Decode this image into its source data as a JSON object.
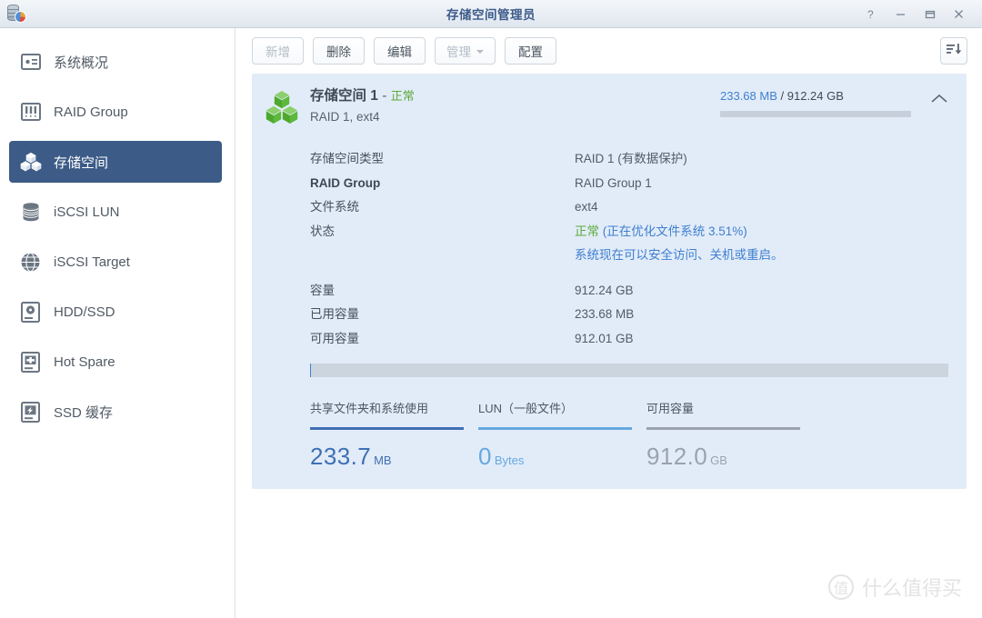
{
  "window": {
    "title": "存储空间管理员",
    "app_icon": "storage-manager-icon",
    "controls": {
      "help": "?",
      "minimize": "−",
      "maximize": "□",
      "close": "✕"
    }
  },
  "sidebar": {
    "items": [
      {
        "label": "系统概况",
        "icon": "overview-card-icon",
        "selected": false
      },
      {
        "label": "RAID Group",
        "icon": "raid-group-icon",
        "selected": false
      },
      {
        "label": "存储空间",
        "icon": "volume-cubes-icon",
        "selected": true
      },
      {
        "label": "iSCSI LUN",
        "icon": "disk-stack-icon",
        "selected": false
      },
      {
        "label": "iSCSI Target",
        "icon": "globe-icon",
        "selected": false
      },
      {
        "label": "HDD/SSD",
        "icon": "hard-drive-icon",
        "selected": false
      },
      {
        "label": "Hot Spare",
        "icon": "plus-drive-icon",
        "selected": false
      },
      {
        "label": "SSD 缓存",
        "icon": "ssd-bolt-icon",
        "selected": false
      }
    ]
  },
  "toolbar": {
    "create_label": "新增",
    "create_disabled": true,
    "delete_label": "删除",
    "edit_label": "编辑",
    "manage_label": "管理",
    "manage_disabled": true,
    "configure_label": "配置",
    "sort_icon": "sort-descending-icon"
  },
  "volume": {
    "icon": "green-cubes-icon",
    "title": "存储空间 1",
    "title_separator": "-",
    "status_short": "正常",
    "subtitle": "RAID 1, ext4",
    "usage_used": "233.68 MB",
    "usage_separator": "/",
    "usage_total": "912.24 GB",
    "usage_percent": 0.025,
    "collapse_icon": "chevron-up-icon",
    "details": [
      {
        "label": "存储空间类型",
        "value": "RAID 1 (有数据保护)",
        "bold": false
      },
      {
        "label": "RAID Group",
        "value": "RAID Group 1",
        "bold": true
      },
      {
        "label": "文件系统",
        "value": "ext4",
        "bold": false
      }
    ],
    "status_row": {
      "label": "状态",
      "value_ok": "正常",
      "value_progress": "(正在优化文件系统 3.51%)",
      "note": "系统现在可以安全访问、关机或重启。"
    },
    "capacity_rows": [
      {
        "label": "容量",
        "value": "912.24 GB"
      },
      {
        "label": "已用容量",
        "value": "233.68 MB"
      },
      {
        "label": "可用容量",
        "value": "912.01 GB"
      }
    ],
    "bar_percent": 0.025,
    "stats": [
      {
        "label": "共享文件夹和系统使用",
        "number": "233.7",
        "unit": "MB",
        "color": "#3f6fb5"
      },
      {
        "label": "LUN（一般文件）",
        "number": "0",
        "unit": "Bytes",
        "color": "#66a8e0"
      },
      {
        "label": "可用容量",
        "number": "912.0",
        "unit": "GB",
        "color": "#9aa3ad"
      }
    ]
  },
  "watermark": {
    "mark": "值",
    "text": "什么值得买"
  }
}
